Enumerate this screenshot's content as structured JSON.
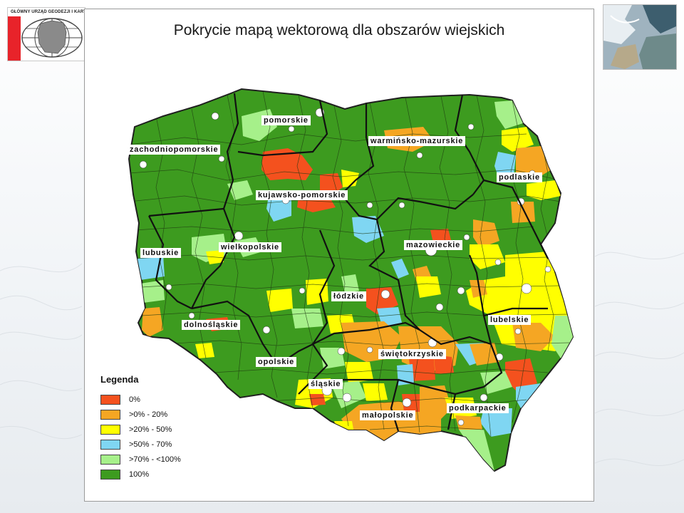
{
  "logo": {
    "text": "GŁÓWNY URZĄD GEODEZJI I KARTO",
    "icon": "poland-globe-logo-icon",
    "color": "#e8232a"
  },
  "satellite": {
    "icon": "satellite-image-icon"
  },
  "map": {
    "title": "Pokrycie mapą wektorową dla obszarów wiejskich",
    "regions": [
      {
        "key": "zachodniopomorskie",
        "label": "zachodniopomorskie"
      },
      {
        "key": "pomorskie",
        "label": "pomorskie"
      },
      {
        "key": "warminsko",
        "label": "warmińsko-mazurskie"
      },
      {
        "key": "podlaskie",
        "label": "podlaskie"
      },
      {
        "key": "kujawsko",
        "label": "kujawsko-pomorskie"
      },
      {
        "key": "lubuskie",
        "label": "lubuskie"
      },
      {
        "key": "wielkopolskie",
        "label": "wielkopolskie"
      },
      {
        "key": "mazowieckie",
        "label": "mazowieckie"
      },
      {
        "key": "lodzkie",
        "label": "łódzkie"
      },
      {
        "key": "lubelskie",
        "label": "lubelskie"
      },
      {
        "key": "dolnoslaskie",
        "label": "dolnośląskie"
      },
      {
        "key": "swietokrzyskie",
        "label": "świętokrzyskie"
      },
      {
        "key": "opolskie",
        "label": "opolskie"
      },
      {
        "key": "slaskie",
        "label": "śląskie"
      },
      {
        "key": "malopolskie",
        "label": "małopolskie"
      },
      {
        "key": "podkarpackie",
        "label": "podkarpackie"
      }
    ]
  },
  "legend": {
    "title": "Legenda",
    "items": [
      {
        "label": "0%",
        "color": "#f4511e"
      },
      {
        "label": ">0% - 20%",
        "color": "#f5a623"
      },
      {
        "label": ">20% - 50%",
        "color": "#ffff00"
      },
      {
        "label": ">50% - 70%",
        "color": "#7fd6f2"
      },
      {
        "label": ">70% - <100%",
        "color": "#a6f08a"
      },
      {
        "label": "100%",
        "color": "#3d9b1f"
      }
    ]
  }
}
